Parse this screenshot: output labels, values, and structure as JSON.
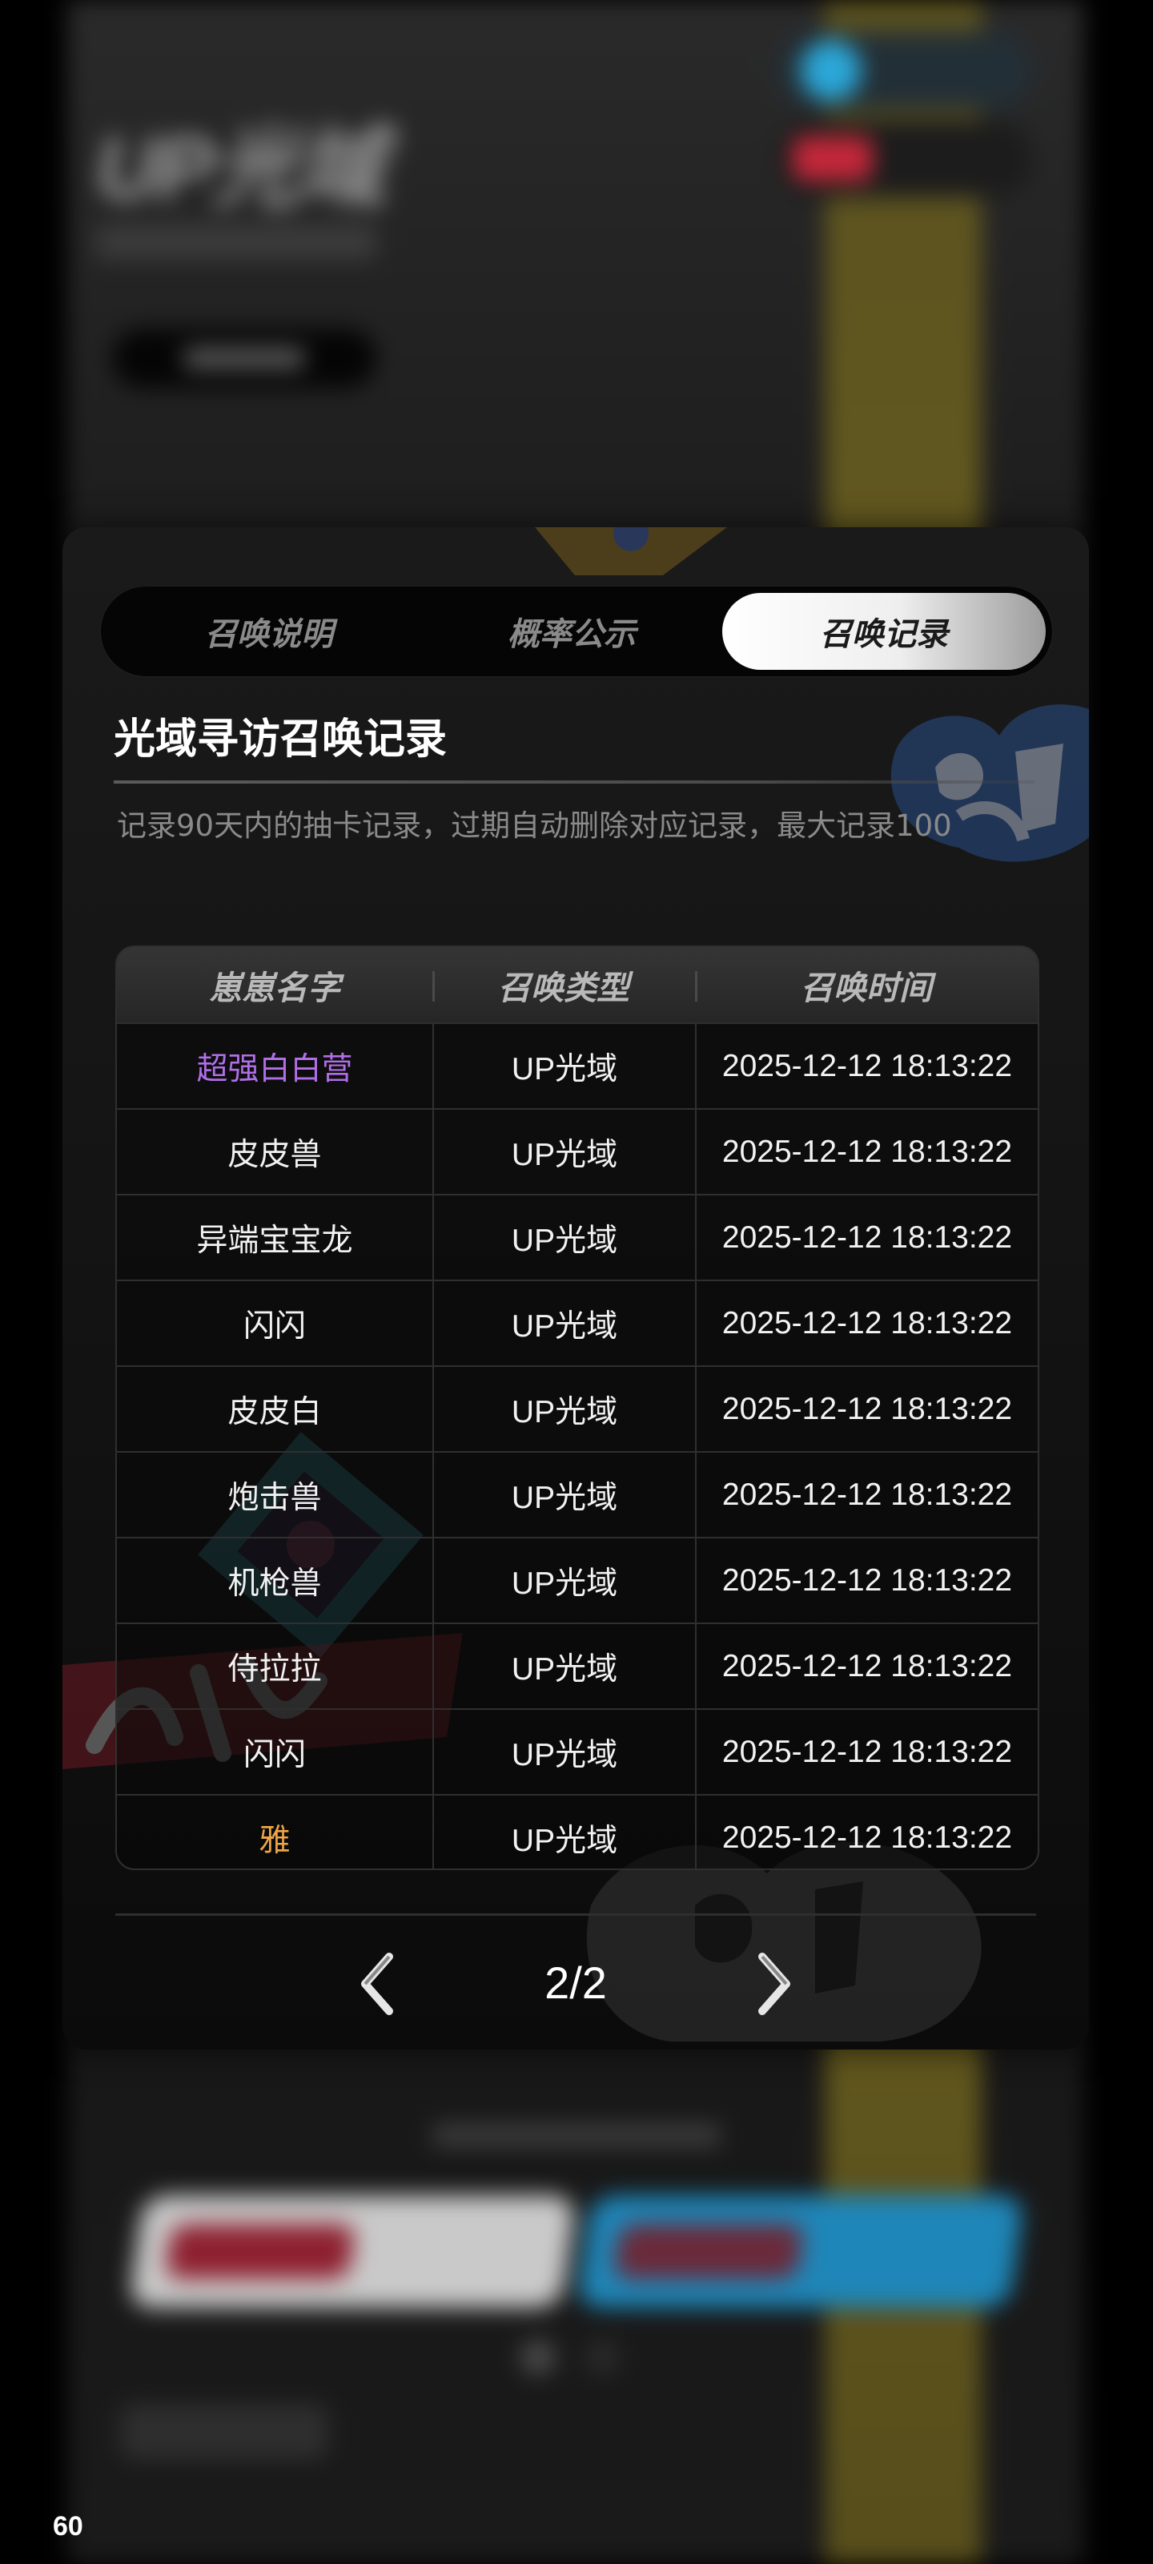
{
  "background": {
    "logo_text": "UP光域"
  },
  "tabs": [
    {
      "label": "召唤说明",
      "active": false
    },
    {
      "label": "概率公示",
      "active": false
    },
    {
      "label": "召唤记录",
      "active": true
    }
  ],
  "record": {
    "title": "光域寻访召唤记录",
    "subtitle": "记录90天内的抽卡记录，过期自动删除对应记录，最大记录100"
  },
  "table": {
    "headers": [
      "崽崽名字",
      "召唤类型",
      "召唤时间"
    ],
    "rows": [
      {
        "name": "超强白白营",
        "type": "UP光域",
        "time": "2025-12-12 18:13:22",
        "name_color": "#b06ee8"
      },
      {
        "name": "皮皮兽",
        "type": "UP光域",
        "time": "2025-12-12 18:13:22",
        "name_color": "#f2f2f2"
      },
      {
        "name": "异端宝宝龙",
        "type": "UP光域",
        "time": "2025-12-12 18:13:22",
        "name_color": "#f2f2f2"
      },
      {
        "name": "闪闪",
        "type": "UP光域",
        "time": "2025-12-12 18:13:22",
        "name_color": "#f2f2f2"
      },
      {
        "name": "皮皮白",
        "type": "UP光域",
        "time": "2025-12-12 18:13:22",
        "name_color": "#f2f2f2"
      },
      {
        "name": "炮击兽",
        "type": "UP光域",
        "time": "2025-12-12 18:13:22",
        "name_color": "#f2f2f2"
      },
      {
        "name": "机枪兽",
        "type": "UP光域",
        "time": "2025-12-12 18:13:22",
        "name_color": "#f2f2f2"
      },
      {
        "name": "侍拉拉",
        "type": "UP光域",
        "time": "2025-12-12 18:13:22",
        "name_color": "#f2f2f2"
      },
      {
        "name": "闪闪",
        "type": "UP光域",
        "time": "2025-12-12 18:13:22",
        "name_color": "#f2f2f2"
      },
      {
        "name": "雅",
        "type": "UP光域",
        "time": "2025-12-12 18:13:22",
        "name_color": "#f0a548"
      }
    ]
  },
  "pagination": {
    "text": "2/2",
    "prev_icon": "chevron-left-icon",
    "next_icon": "chevron-right-icon"
  },
  "fps": "60",
  "colors": {
    "tab_active": "#f2f2f2",
    "rare_purple": "#b06ee8",
    "rare_orange": "#f0a548"
  }
}
